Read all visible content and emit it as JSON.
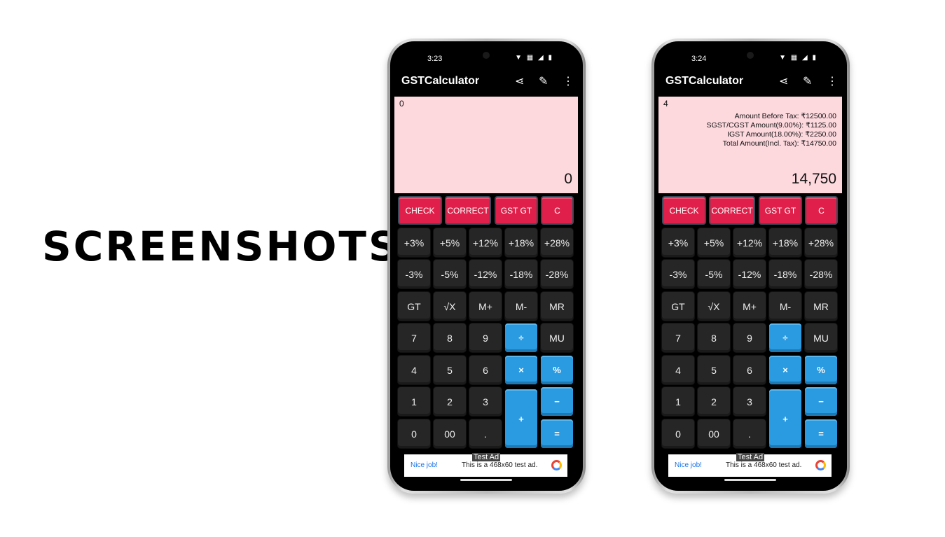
{
  "headline": "SCREENSHOTS",
  "phones": [
    {
      "time": "3:23",
      "status_icons": "▼ ▦ ◢ ▮",
      "app_title": "GSTCalculator",
      "expression": "0",
      "details": [],
      "result": "0"
    },
    {
      "time": "3:24",
      "status_icons": "▼ ▦ ◢ ▮",
      "app_title": "GSTCalculator",
      "expression": "4",
      "details": [
        "Amount Before Tax: ₹12500.00",
        "SGST/CGST Amount(9.00%): ₹1125.00",
        "IGST Amount(18.00%): ₹2250.00",
        "Total Amount(Incl. Tax): ₹14750.00"
      ],
      "result": "14,750"
    }
  ],
  "icons": {
    "share": "share-icon",
    "feedback": "feedback-icon",
    "menu": "more-vert-icon"
  },
  "top_buttons": [
    "CHECK",
    "CORRECT",
    "GST GT",
    "C"
  ],
  "keys": [
    [
      "+3%",
      "+5%",
      "+12%",
      "+18%",
      "+28%"
    ],
    [
      "-3%",
      "-5%",
      "-12%",
      "-18%",
      "-28%"
    ],
    [
      "GT",
      "√X",
      "M+",
      "M-",
      "MR"
    ],
    [
      "7",
      "8",
      "9",
      "÷",
      "MU"
    ],
    [
      "4",
      "5",
      "6",
      "×",
      "%"
    ],
    [
      "1",
      "2",
      "3",
      "+",
      "−"
    ],
    [
      "0",
      "00",
      ".",
      "",
      "="
    ]
  ],
  "ad": {
    "label": "Test Ad",
    "nice": "Nice job!",
    "message": "This is a 468x60 test ad."
  },
  "colors": {
    "display_bg": "#fdd9de",
    "red_button": "#e0204a",
    "blue_button": "#2a9be0",
    "dark_button": "#262626"
  }
}
